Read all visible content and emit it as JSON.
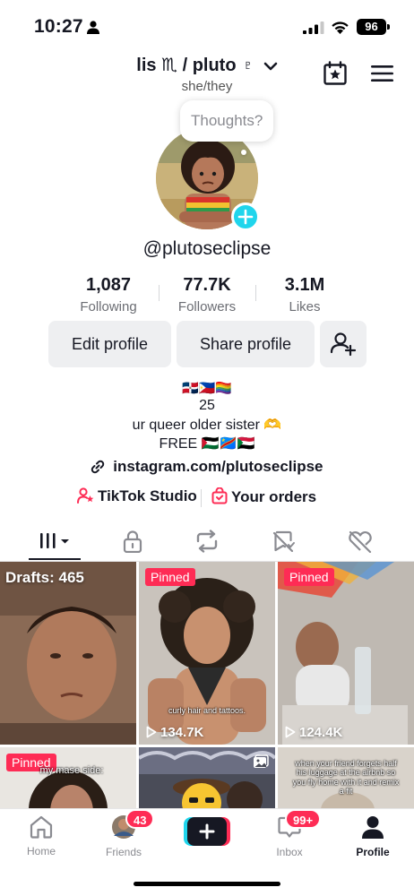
{
  "status_bar": {
    "time": "10:27",
    "battery": "96"
  },
  "header": {
    "display_name": "lis ♏ / pluto ♇",
    "pronouns": "she/they"
  },
  "profile": {
    "thoughts_placeholder": "Thoughts?",
    "username": "@plutoseclipse"
  },
  "stats": [
    {
      "value": "1,087",
      "label": "Following"
    },
    {
      "value": "77.7K",
      "label": "Followers"
    },
    {
      "value": "3.1M",
      "label": "Likes"
    }
  ],
  "buttons": {
    "edit": "Edit profile",
    "share": "Share profile"
  },
  "bio": {
    "flags": "🇩🇴🇵🇭🏳️‍🌈",
    "age": "25",
    "line": "ur queer older sister 🫶",
    "free": "FREE 🇵🇸🇨🇩🇸🇩",
    "link": "instagram.com/plutoseclipse"
  },
  "studio": {
    "tiktok_studio": "TikTok Studio",
    "orders": "Your orders"
  },
  "grid": [
    {
      "label": "Drafts: 465"
    },
    {
      "badge": "Pinned",
      "caption": "curly hair and tattoos.",
      "views": "134.7K"
    },
    {
      "badge": "Pinned",
      "views": "124.4K"
    },
    {
      "badge": "Pinned",
      "caption": "my mase side:"
    },
    {},
    {
      "caption": "when your friend forgets half his luggage at the airbnb so you fly home with it and remix a fit"
    }
  ],
  "bottom_nav": {
    "home": "Home",
    "friends": "Friends",
    "friends_badge": "43",
    "inbox": "Inbox",
    "inbox_badge": "99+",
    "profile": "Profile"
  },
  "colors": {
    "accent": "#fe2c55",
    "cyan": "#20d5ec",
    "button_bg": "#eeeff1"
  }
}
